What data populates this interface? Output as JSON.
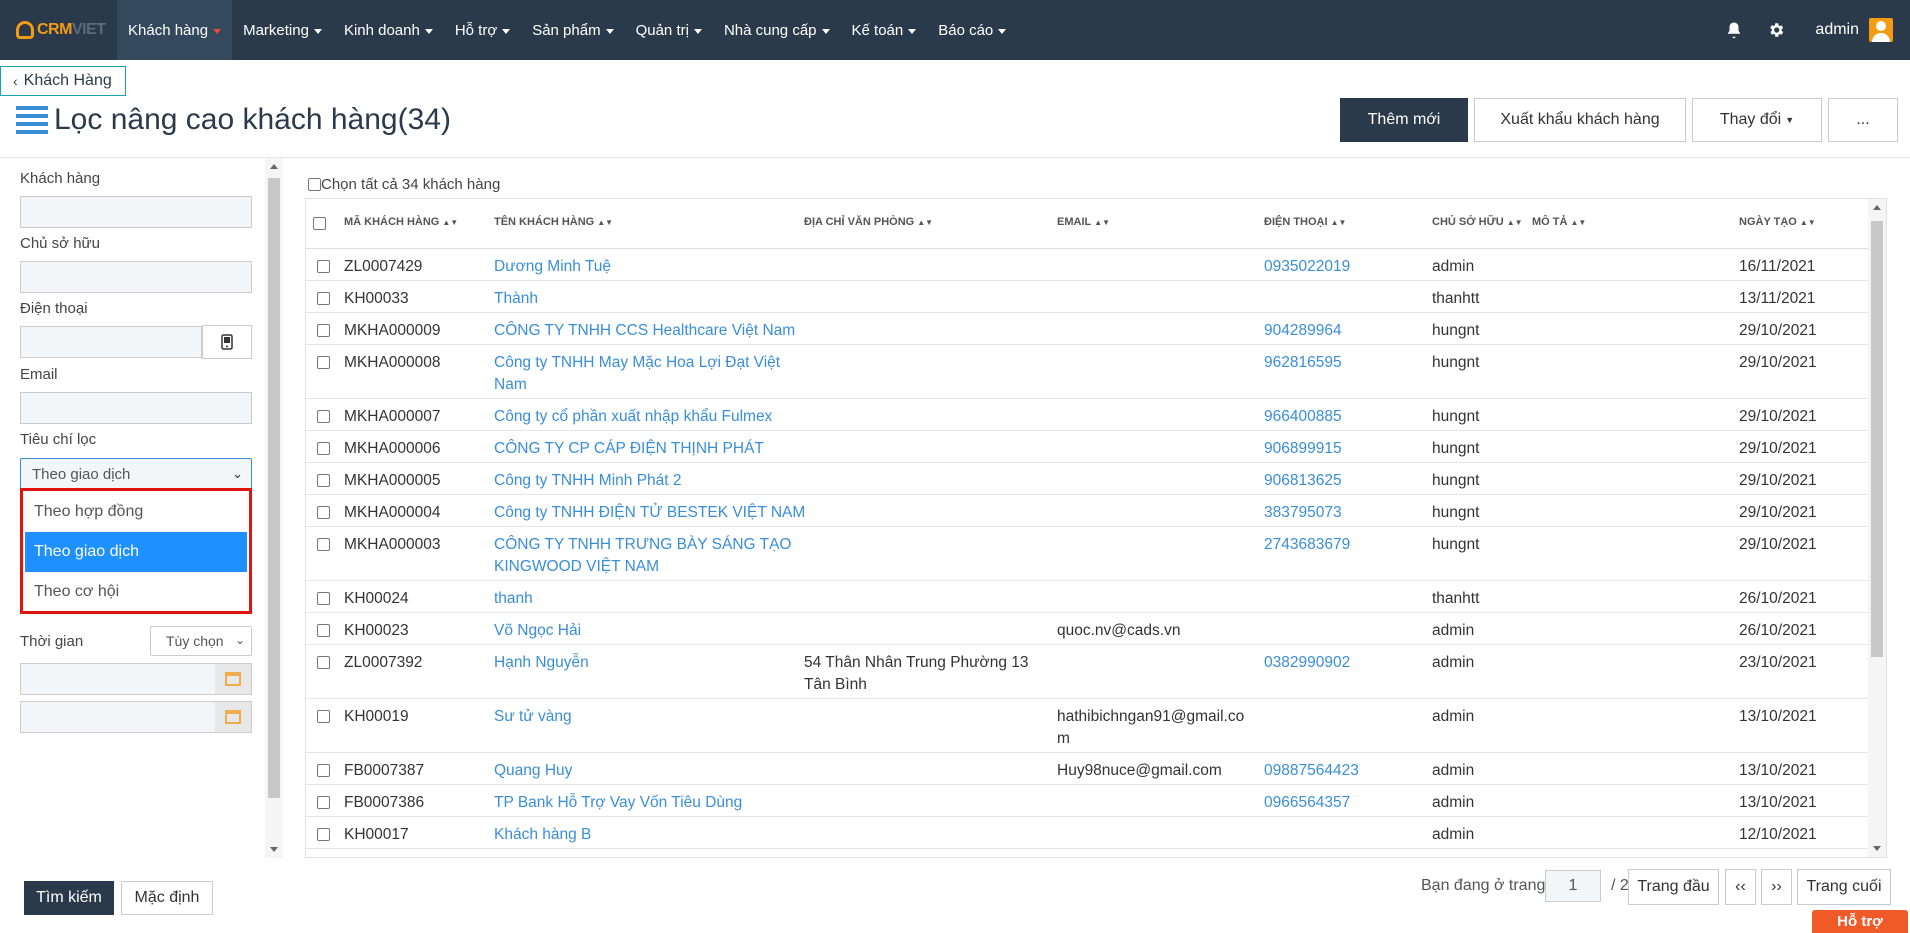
{
  "nav": {
    "logo_a": "CRM",
    "logo_b": "VIET",
    "items": [
      {
        "label": "Khách hàng"
      },
      {
        "label": "Marketing"
      },
      {
        "label": "Kinh doanh"
      },
      {
        "label": "Hỗ trợ"
      },
      {
        "label": "Sản phẩm"
      },
      {
        "label": "Quản trị"
      },
      {
        "label": "Nhà cung cấp"
      },
      {
        "label": "Kế toán"
      },
      {
        "label": "Báo cáo"
      }
    ],
    "user": "admin",
    "icons": [
      "bell-icon",
      "gear-icon",
      "user-avatar-icon"
    ],
    "colors": {
      "bar": "#2b3a4a",
      "accent": "#f39c12"
    }
  },
  "breadcrumb": {
    "back_label": "Khách Hàng"
  },
  "page": {
    "title": "Lọc nâng cao khách hàng(34)"
  },
  "actions": {
    "add": "Thêm mới",
    "export": "Xuất khẩu khách hàng",
    "change": "Thay đổi",
    "more": "..."
  },
  "filters": {
    "customer_label": "Khách hàng",
    "owner_label": "Chủ sở hữu",
    "phone_label": "Điện thoại",
    "email_label": "Email",
    "criteria_label": "Tiêu chí lọc",
    "criteria_value": "Theo giao dịch",
    "criteria_options": [
      "Theo hợp đồng",
      "Theo giao dịch",
      "Theo cơ hội"
    ],
    "time_label": "Thời gian",
    "time_value": "Tùy chọn",
    "search_button": "Tìm kiếm",
    "default_button": "Mặc định"
  },
  "table": {
    "select_all": "Chọn tất cả 34 khách hàng",
    "columns": [
      "MÃ KHÁCH HÀNG",
      "TÊN KHÁCH HÀNG",
      "ĐỊA CHỈ VĂN PHÒNG",
      "EMAIL",
      "ĐIỆN THOẠI",
      "CHỦ SỞ HỮU",
      "MÔ TẢ",
      "NGÀY TẠO"
    ],
    "rows": [
      {
        "code": "ZL0007429",
        "name": "Dương Minh Tuệ",
        "addr": "",
        "addr2": "",
        "email": "",
        "email2": "",
        "phone": "0935022019",
        "owner": "admin",
        "desc": "",
        "date": "16/11/2021",
        "name2": ""
      },
      {
        "code": "KH00033",
        "name": "Thành",
        "addr": "",
        "addr2": "",
        "email": "",
        "email2": "",
        "phone": "",
        "owner": "thanhtt",
        "desc": "",
        "date": "13/11/2021",
        "name2": ""
      },
      {
        "code": "MKHA000009",
        "name": "CÔNG TY TNHH CCS Healthcare Việt Nam",
        "addr": "",
        "addr2": "",
        "email": "",
        "email2": "",
        "phone": "904289964",
        "owner": "hungnt",
        "desc": "",
        "date": "29/10/2021",
        "name2": ""
      },
      {
        "code": "MKHA000008",
        "name": "Công ty TNHH May Mặc Hoa Lợi Đạt Việt",
        "name2": "Nam",
        "addr": "",
        "addr2": "",
        "email": "",
        "email2": "",
        "phone": "962816595",
        "owner": "hungnt",
        "desc": "",
        "date": "29/10/2021"
      },
      {
        "code": "MKHA000007",
        "name": "Công ty cổ phần xuất nhập khẩu Fulmex",
        "addr": "",
        "addr2": "",
        "email": "",
        "email2": "",
        "phone": "966400885",
        "owner": "hungnt",
        "desc": "",
        "date": "29/10/2021",
        "name2": ""
      },
      {
        "code": "MKHA000006",
        "name": "CÔNG TY CP CÁP ĐIỆN THỊNH PHÁT",
        "addr": "",
        "addr2": "",
        "email": "",
        "email2": "",
        "phone": "906899915",
        "owner": "hungnt",
        "desc": "",
        "date": "29/10/2021",
        "name2": ""
      },
      {
        "code": "MKHA000005",
        "name": "Công ty TNHH Minh Phát 2",
        "addr": "",
        "addr2": "",
        "email": "",
        "email2": "",
        "phone": "906813625",
        "owner": "hungnt",
        "desc": "",
        "date": "29/10/2021",
        "name2": ""
      },
      {
        "code": "MKHA000004",
        "name": "Công ty TNHH ĐIỆN TỬ BESTEK VIỆT NAM",
        "addr": "",
        "addr2": "",
        "email": "",
        "email2": "",
        "phone": "383795073",
        "owner": "hungnt",
        "desc": "",
        "date": "29/10/2021",
        "name2": ""
      },
      {
        "code": "MKHA000003",
        "name": "CÔNG TY TNHH TRƯNG BÀY SÁNG TẠO",
        "name2": "KINGWOOD VIỆT NAM",
        "addr": "",
        "addr2": "",
        "email": "",
        "email2": "",
        "phone": "2743683679",
        "owner": "hungnt",
        "desc": "",
        "date": "29/10/2021"
      },
      {
        "code": "KH00024",
        "name": "thanh",
        "addr": "",
        "addr2": "",
        "email": "",
        "email2": "",
        "phone": "",
        "owner": "thanhtt",
        "desc": "",
        "date": "26/10/2021",
        "name2": ""
      },
      {
        "code": "KH00023",
        "name": "Võ Ngọc Hải",
        "addr": "",
        "addr2": "",
        "email": "quoc.nv@cads.vn",
        "email2": "",
        "phone": "",
        "owner": "admin",
        "desc": "",
        "date": "26/10/2021",
        "name2": ""
      },
      {
        "code": "ZL0007392",
        "name": "Hạnh Nguyễn",
        "addr": "54 Thân Nhân Trung Phường 13",
        "addr2": "Tân Bình",
        "email": "",
        "email2": "",
        "phone": "0382990902",
        "owner": "admin",
        "desc": "",
        "date": "23/10/2021",
        "name2": ""
      },
      {
        "code": "KH00019",
        "name": "Sư tử vàng",
        "addr": "",
        "addr2": "",
        "email": "hathibichngan91@gmail.co",
        "email2": "m",
        "phone": "",
        "owner": "admin",
        "desc": "",
        "date": "13/10/2021",
        "name2": ""
      },
      {
        "code": "FB0007387",
        "name": "Quang Huy",
        "addr": "",
        "addr2": "",
        "email": "Huy98nuce@gmail.com",
        "email2": "",
        "phone": "09887564423",
        "owner": "admin",
        "desc": "",
        "date": "13/10/2021",
        "name2": ""
      },
      {
        "code": "FB0007386",
        "name": "TP Bank Hỗ Trợ Vay Vốn Tiêu Dùng",
        "addr": "",
        "addr2": "",
        "email": "",
        "email2": "",
        "phone": "0966564357",
        "owner": "admin",
        "desc": "",
        "date": "13/10/2021",
        "name2": ""
      },
      {
        "code": "KH00017",
        "name": "Khách hàng B",
        "addr": "",
        "addr2": "",
        "email": "",
        "email2": "",
        "phone": "",
        "owner": "admin",
        "desc": "",
        "date": "12/10/2021",
        "name2": ""
      }
    ]
  },
  "pager": {
    "prefix": "Bạn đang ở trang",
    "current": "1",
    "total": "/ 2",
    "first": "Trang đầu",
    "prev": "‹‹",
    "next": "››",
    "last": "Trang cuối"
  },
  "help": "Hỗ trợ"
}
